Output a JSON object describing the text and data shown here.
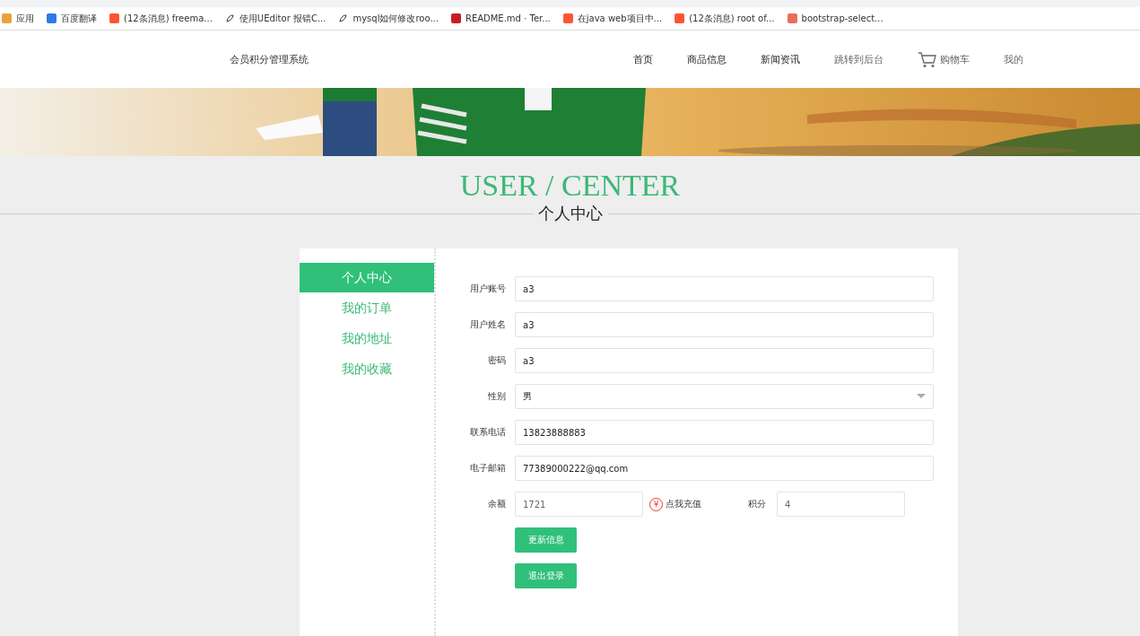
{
  "bookmarks": [
    {
      "label": "应用",
      "kind": "apps"
    },
    {
      "label": "百度翻译",
      "kind": "translate"
    },
    {
      "label": "(12条消息) freema...",
      "kind": "csdn"
    },
    {
      "label": "使用UEditor 报错C...",
      "kind": "other"
    },
    {
      "label": "mysql如何修改roo...",
      "kind": "other"
    },
    {
      "label": "README.md · Ter...",
      "kind": "gitee"
    },
    {
      "label": "在java web项目中...",
      "kind": "csdn"
    },
    {
      "label": "(12条消息) root of...",
      "kind": "csdn"
    },
    {
      "label": "bootstrap-select...",
      "kind": "jianshu"
    }
  ],
  "site_title": "会员积分管理系统",
  "nav": [
    {
      "label": "首页",
      "kind": "link"
    },
    {
      "label": "商品信息",
      "kind": "link"
    },
    {
      "label": "新闻资讯",
      "kind": "link"
    },
    {
      "label": "跳转到后台",
      "kind": "muted"
    },
    {
      "label": "购物车",
      "kind": "cart"
    },
    {
      "label": "我的",
      "kind": "muted"
    }
  ],
  "heading": {
    "title": "USER / CENTER",
    "subtitle": "个人中心"
  },
  "sidebar": {
    "items": [
      {
        "label": "个人中心",
        "selected": true
      },
      {
        "label": "我的订单",
        "selected": false
      },
      {
        "label": "我的地址",
        "selected": false
      },
      {
        "label": "我的收藏",
        "selected": false
      }
    ]
  },
  "form": {
    "fields": [
      {
        "label": "用户账号",
        "value": "a3",
        "kind": "text"
      },
      {
        "label": "用户姓名",
        "value": "a3",
        "kind": "text"
      },
      {
        "label": "密码",
        "value": "a3",
        "kind": "text"
      },
      {
        "label": "性别",
        "value": "男",
        "kind": "select"
      },
      {
        "label": "联系电话",
        "value": "13823888883",
        "kind": "text"
      },
      {
        "label": "电子邮箱",
        "value": "77389000222@qq.com",
        "kind": "text"
      }
    ],
    "balance": {
      "label": "余额",
      "value": "1721",
      "recharge": "点我充值",
      "icon": "¥"
    },
    "points": {
      "label": "积分",
      "value": "4"
    },
    "buttons": [
      "更新信息",
      "退出登录"
    ]
  }
}
